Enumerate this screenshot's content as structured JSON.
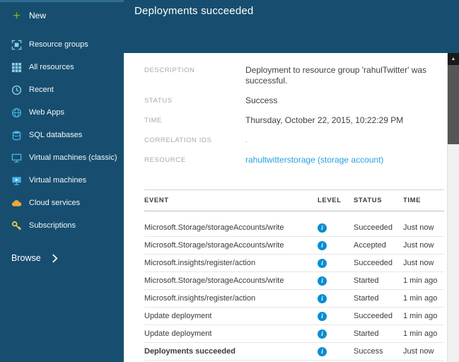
{
  "colors": {
    "sidebar_bg": "#174E6F",
    "accent_green": "#7FBA00",
    "link_blue": "#24A3DC",
    "info_blue": "#0B8DD0",
    "icon_light_blue": "#8ECDE9",
    "key_yellow": "#FDD344",
    "cloud_orange": "#EDA73E"
  },
  "sidebar": {
    "new_label": "New",
    "items": [
      {
        "label": "Resource groups"
      },
      {
        "label": "All resources"
      },
      {
        "label": "Recent"
      },
      {
        "label": "Web Apps"
      },
      {
        "label": "SQL databases"
      },
      {
        "label": "Virtual machines (classic)"
      },
      {
        "label": "Virtual machines"
      },
      {
        "label": "Cloud services"
      },
      {
        "label": "Subscriptions"
      }
    ],
    "browse_label": "Browse"
  },
  "header": {
    "title": "Deployments succeeded"
  },
  "details": {
    "description": {
      "label": "DESCRIPTION",
      "value": "Deployment to resource group 'rahulTwitter' was successful."
    },
    "status": {
      "label": "STATUS",
      "value": "Success"
    },
    "time": {
      "label": "TIME",
      "value": "Thursday, October 22, 2015, 10:22:29 PM"
    },
    "correlation": {
      "label": "CORRELATION IDS",
      "value": "."
    },
    "resource": {
      "label": "RESOURCE",
      "value": "rahultwitterstorage (storage account)"
    }
  },
  "events": {
    "columns": {
      "event": "EVENT",
      "level": "LEVEL",
      "status": "STATUS",
      "time": "TIME"
    },
    "rows": [
      {
        "event": "Microsoft.Storage/storageAccounts/write",
        "status": "Succeeded",
        "time": "Just now"
      },
      {
        "event": "Microsoft.Storage/storageAccounts/write",
        "status": "Accepted",
        "time": "Just now"
      },
      {
        "event": "Microsoft.insights/register/action",
        "status": "Succeeded",
        "time": "Just now"
      },
      {
        "event": "Microsoft.Storage/storageAccounts/write",
        "status": "Started",
        "time": "1 min ago"
      },
      {
        "event": "Microsoft.insights/register/action",
        "status": "Started",
        "time": "1 min ago"
      },
      {
        "event": "Update deployment",
        "status": "Succeeded",
        "time": "1 min ago"
      },
      {
        "event": "Update deployment",
        "status": "Started",
        "time": "1 min ago"
      },
      {
        "event": "Deployments succeeded",
        "status": "Success",
        "time": "Just now"
      }
    ]
  },
  "icons": {
    "plus": "+",
    "info": "i",
    "scroll_up": "▲"
  }
}
